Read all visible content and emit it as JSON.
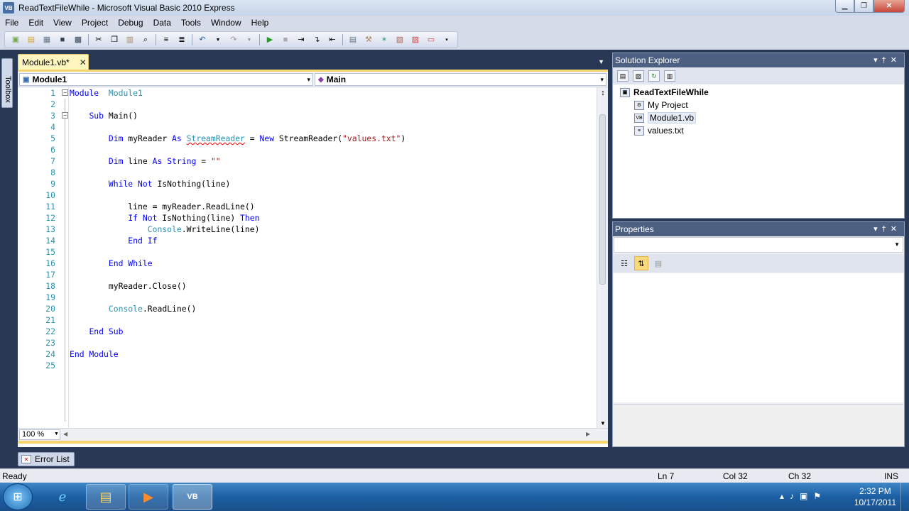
{
  "window": {
    "title": "ReadTextFileWhile - Microsoft Visual Basic 2010 Express",
    "app_icon": "VB"
  },
  "menu": [
    "File",
    "Edit",
    "View",
    "Project",
    "Debug",
    "Data",
    "Tools",
    "Window",
    "Help"
  ],
  "toolbox": {
    "label": "Toolbox"
  },
  "editor": {
    "tab_label": "Module1.vb*",
    "nav_left": "Module1",
    "nav_right": "Main",
    "zoom": "100 %",
    "lines": [
      {
        "n": "1",
        "segs": [
          [
            "kw",
            "Module"
          ],
          [
            "",
            "  "
          ],
          [
            "ty",
            "Module1"
          ]
        ]
      },
      {
        "n": "2",
        "segs": []
      },
      {
        "n": "3",
        "segs": [
          [
            "",
            "    "
          ],
          [
            "kw",
            "Sub"
          ],
          [
            "",
            " Main()"
          ]
        ]
      },
      {
        "n": "4",
        "segs": []
      },
      {
        "n": "5",
        "segs": [
          [
            "",
            "        "
          ],
          [
            "kw",
            "Dim"
          ],
          [
            "",
            " myReader "
          ],
          [
            "kw",
            "As"
          ],
          [
            "",
            " "
          ],
          [
            "sq",
            "StreamReader"
          ],
          [
            "",
            " = "
          ],
          [
            "kw",
            "New"
          ],
          [
            "",
            " StreamReader("
          ],
          [
            "st",
            "\"values.txt\""
          ],
          [
            "",
            ")"
          ]
        ]
      },
      {
        "n": "6",
        "segs": []
      },
      {
        "n": "7",
        "segs": [
          [
            "",
            "        "
          ],
          [
            "kw",
            "Dim"
          ],
          [
            "",
            " line "
          ],
          [
            "kw",
            "As"
          ],
          [
            "",
            " "
          ],
          [
            "kw",
            "String"
          ],
          [
            "",
            " = "
          ],
          [
            "st",
            "\"\""
          ]
        ]
      },
      {
        "n": "8",
        "segs": []
      },
      {
        "n": "9",
        "segs": [
          [
            "",
            "        "
          ],
          [
            "kw",
            "While"
          ],
          [
            "",
            " "
          ],
          [
            "kw",
            "Not"
          ],
          [
            "",
            " IsNothing(line)"
          ]
        ]
      },
      {
        "n": "10",
        "segs": []
      },
      {
        "n": "11",
        "segs": [
          [
            "",
            "            line = myReader.ReadLine()"
          ]
        ]
      },
      {
        "n": "12",
        "segs": [
          [
            "",
            "            "
          ],
          [
            "kw",
            "If"
          ],
          [
            "",
            " "
          ],
          [
            "kw",
            "Not"
          ],
          [
            "",
            " IsNothing(line) "
          ],
          [
            "kw",
            "Then"
          ]
        ]
      },
      {
        "n": "13",
        "segs": [
          [
            "",
            "                "
          ],
          [
            "ty",
            "Console"
          ],
          [
            "",
            ".WriteLine(line)"
          ]
        ]
      },
      {
        "n": "14",
        "segs": [
          [
            "",
            "            "
          ],
          [
            "kw",
            "End If"
          ]
        ]
      },
      {
        "n": "15",
        "segs": []
      },
      {
        "n": "16",
        "segs": [
          [
            "",
            "        "
          ],
          [
            "kw",
            "End While"
          ]
        ]
      },
      {
        "n": "17",
        "segs": []
      },
      {
        "n": "18",
        "segs": [
          [
            "",
            "        myReader.Close()"
          ]
        ]
      },
      {
        "n": "19",
        "segs": []
      },
      {
        "n": "20",
        "segs": [
          [
            "",
            "        "
          ],
          [
            "ty",
            "Console"
          ],
          [
            "",
            ".ReadLine()"
          ]
        ]
      },
      {
        "n": "21",
        "segs": []
      },
      {
        "n": "22",
        "segs": [
          [
            "",
            "    "
          ],
          [
            "kw",
            "End Sub"
          ]
        ]
      },
      {
        "n": "23",
        "segs": []
      },
      {
        "n": "24",
        "segs": [
          [
            "kw",
            "End Module"
          ]
        ]
      },
      {
        "n": "25",
        "segs": []
      }
    ]
  },
  "solution_explorer": {
    "title": "Solution Explorer",
    "root": "ReadTextFileWhile",
    "items": [
      "My Project",
      "Module1.vb",
      "values.txt"
    ]
  },
  "properties": {
    "title": "Properties"
  },
  "error_list": {
    "label": "Error List"
  },
  "status": {
    "ready": "Ready",
    "ln": "Ln 7",
    "col": "Col 32",
    "ch": "Ch 32",
    "ins": "INS"
  },
  "taskbar": {
    "time": "2:32 PM",
    "date": "10/17/2011"
  },
  "colors": {
    "keyword": "#0000ff",
    "type": "#2b91af",
    "string": "#a31515",
    "ide_background": "#293955"
  }
}
